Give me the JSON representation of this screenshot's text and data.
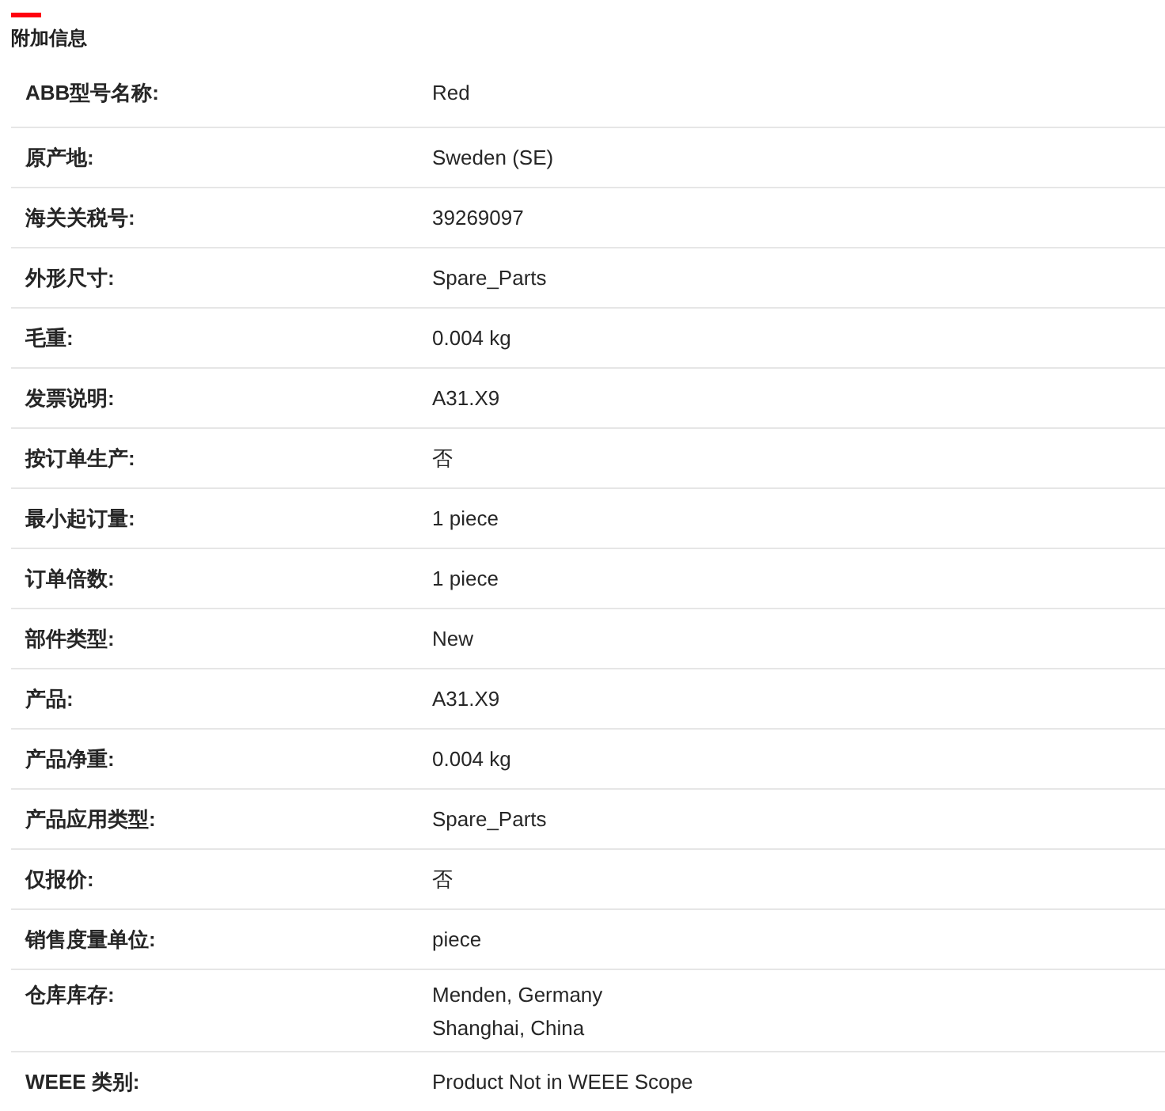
{
  "section": {
    "title": "附加信息"
  },
  "rows": [
    {
      "label": "ABB型号名称:",
      "lines": [
        "Red"
      ]
    },
    {
      "label": "原产地:",
      "lines": [
        "Sweden (SE)"
      ]
    },
    {
      "label": "海关关税号:",
      "lines": [
        "39269097"
      ]
    },
    {
      "label": "外形尺寸:",
      "lines": [
        "Spare_Parts"
      ]
    },
    {
      "label": "毛重:",
      "lines": [
        "0.004 kg"
      ]
    },
    {
      "label": "发票说明:",
      "lines": [
        "A31.X9"
      ]
    },
    {
      "label": "按订单生产:",
      "lines": [
        "否"
      ]
    },
    {
      "label": "最小起订量:",
      "lines": [
        "1 piece"
      ]
    },
    {
      "label": "订单倍数:",
      "lines": [
        "1 piece"
      ]
    },
    {
      "label": "部件类型:",
      "lines": [
        "New"
      ]
    },
    {
      "label": "产品:",
      "lines": [
        "A31.X9"
      ]
    },
    {
      "label": "产品净重:",
      "lines": [
        "0.004 kg"
      ]
    },
    {
      "label": "产品应用类型:",
      "lines": [
        "Spare_Parts"
      ]
    },
    {
      "label": "仅报价:",
      "lines": [
        "否"
      ]
    },
    {
      "label": "销售度量单位:",
      "lines": [
        "piece"
      ]
    },
    {
      "label": "仓库库存:",
      "lines": [
        "Menden, Germany",
        "Shanghai, China"
      ]
    },
    {
      "label": "WEEE 类别:",
      "lines": [
        "Product Not in WEEE Scope"
      ]
    }
  ]
}
